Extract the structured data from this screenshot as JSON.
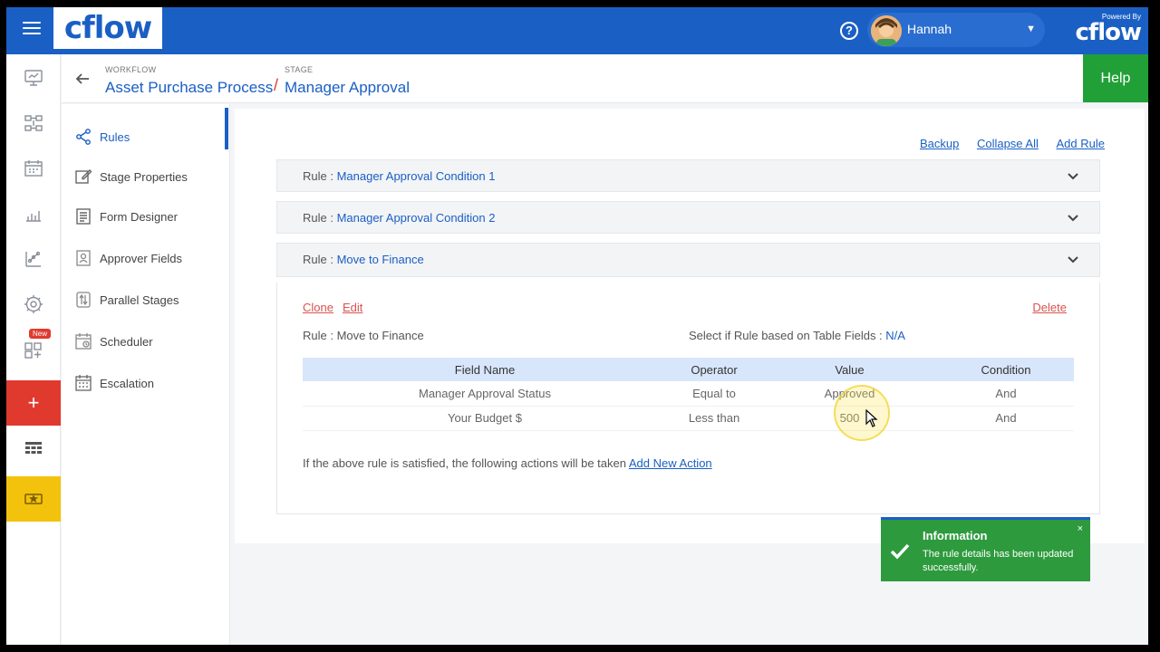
{
  "topbar": {
    "logo": "cflow",
    "user_name": "Hannah",
    "help_glyph": "?",
    "powered_by_label": "Powered By",
    "powered_by_logo": "cflow"
  },
  "rail": {
    "new_badge": "New",
    "add_glyph": "+"
  },
  "header": {
    "workflow_label": "WORKFLOW",
    "workflow_name": "Asset Purchase Process",
    "separator": "/",
    "stage_label": "STAGE",
    "stage_name": "Manager Approval",
    "help_button": "Help"
  },
  "stage_nav": {
    "items": [
      {
        "label": "Rules"
      },
      {
        "label": "Stage Properties"
      },
      {
        "label": "Form Designer"
      },
      {
        "label": "Approver Fields"
      },
      {
        "label": "Parallel Stages"
      },
      {
        "label": "Scheduler"
      },
      {
        "label": "Escalation"
      }
    ]
  },
  "main": {
    "links": {
      "backup": "Backup",
      "collapse_all": "Collapse All",
      "add_rule": "Add Rule"
    },
    "rule_prefix": "Rule : ",
    "rules": [
      {
        "name": "Manager Approval Condition 1"
      },
      {
        "name": "Manager Approval Condition 2"
      },
      {
        "name": "Move to Finance"
      }
    ],
    "expanded": {
      "clone": "Clone",
      "edit": "Edit",
      "delete": "Delete",
      "rule_name_line": "Rule : Move to Finance",
      "table_fields_label": "Select if Rule based on Table Fields : ",
      "table_fields_value": "N/A",
      "columns": [
        "Field Name",
        "Operator",
        "Value",
        "Condition"
      ],
      "rows": [
        [
          "Manager Approval Status",
          "Equal to",
          "Approved",
          "And"
        ],
        [
          "Your Budget $",
          "Less than",
          "500",
          "And"
        ]
      ],
      "action_text": "If the above rule is satisfied, the following actions will be taken ",
      "add_new_action": "Add New Action"
    }
  },
  "toast": {
    "title": "Information",
    "message": "The rule details has been updated successfully.",
    "close": "×"
  },
  "colors": {
    "brand_blue": "#1a5fc4",
    "help_green": "#21a038",
    "add_red": "#e03a2f",
    "gold": "#f3c20c",
    "toast_green": "#2e9a3e"
  }
}
